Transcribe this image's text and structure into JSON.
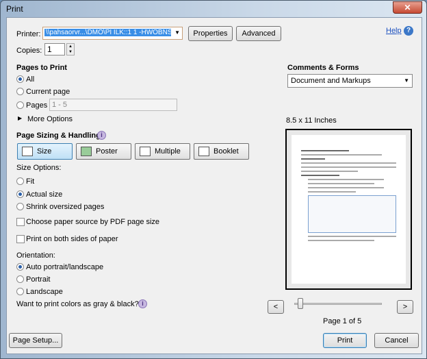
{
  "window": {
    "title": "Print",
    "close": "✕"
  },
  "printer": {
    "label": "Printer:",
    "value": "\\\\pahsaorvr...\\DMO\\PI ILK::1 1 -HWOBNS",
    "properties": "Properties",
    "advanced": "Advanced"
  },
  "help": {
    "label": "Help",
    "icon": "?"
  },
  "copies": {
    "label": "Copies:",
    "value": "1"
  },
  "pages": {
    "header": "Pages to Print",
    "all": "All",
    "current": "Current page",
    "pages": "Pages",
    "range_placeholder": "1 - 5",
    "more": "More Options"
  },
  "sizing": {
    "header": "Page Sizing & Handling",
    "info": "i",
    "buttons": [
      "Size",
      "Poster",
      "Multiple",
      "Booklet"
    ],
    "options_label": "Size Options:",
    "fit": "Fit",
    "actual": "Actual size",
    "shrink": "Shrink oversized pages",
    "choose_source": "Choose paper source by PDF page size",
    "both_sides": "Print on both sides of paper"
  },
  "orientation": {
    "label": "Orientation:",
    "auto": "Auto portrait/landscape",
    "portrait": "Portrait",
    "landscape": "Landscape"
  },
  "gray": {
    "label": "Want to print colors as gray & black?",
    "info": "i"
  },
  "comments": {
    "header": "Comments & Forms",
    "value": "Document and Markups"
  },
  "preview": {
    "size": "8.5 x 11 Inches",
    "prev": "<",
    "next": ">",
    "page_status": "Page 1 of 5",
    "slider_fraction": 0
  },
  "footer": {
    "page_setup": "Page Setup...",
    "print": "Print",
    "cancel": "Cancel"
  }
}
